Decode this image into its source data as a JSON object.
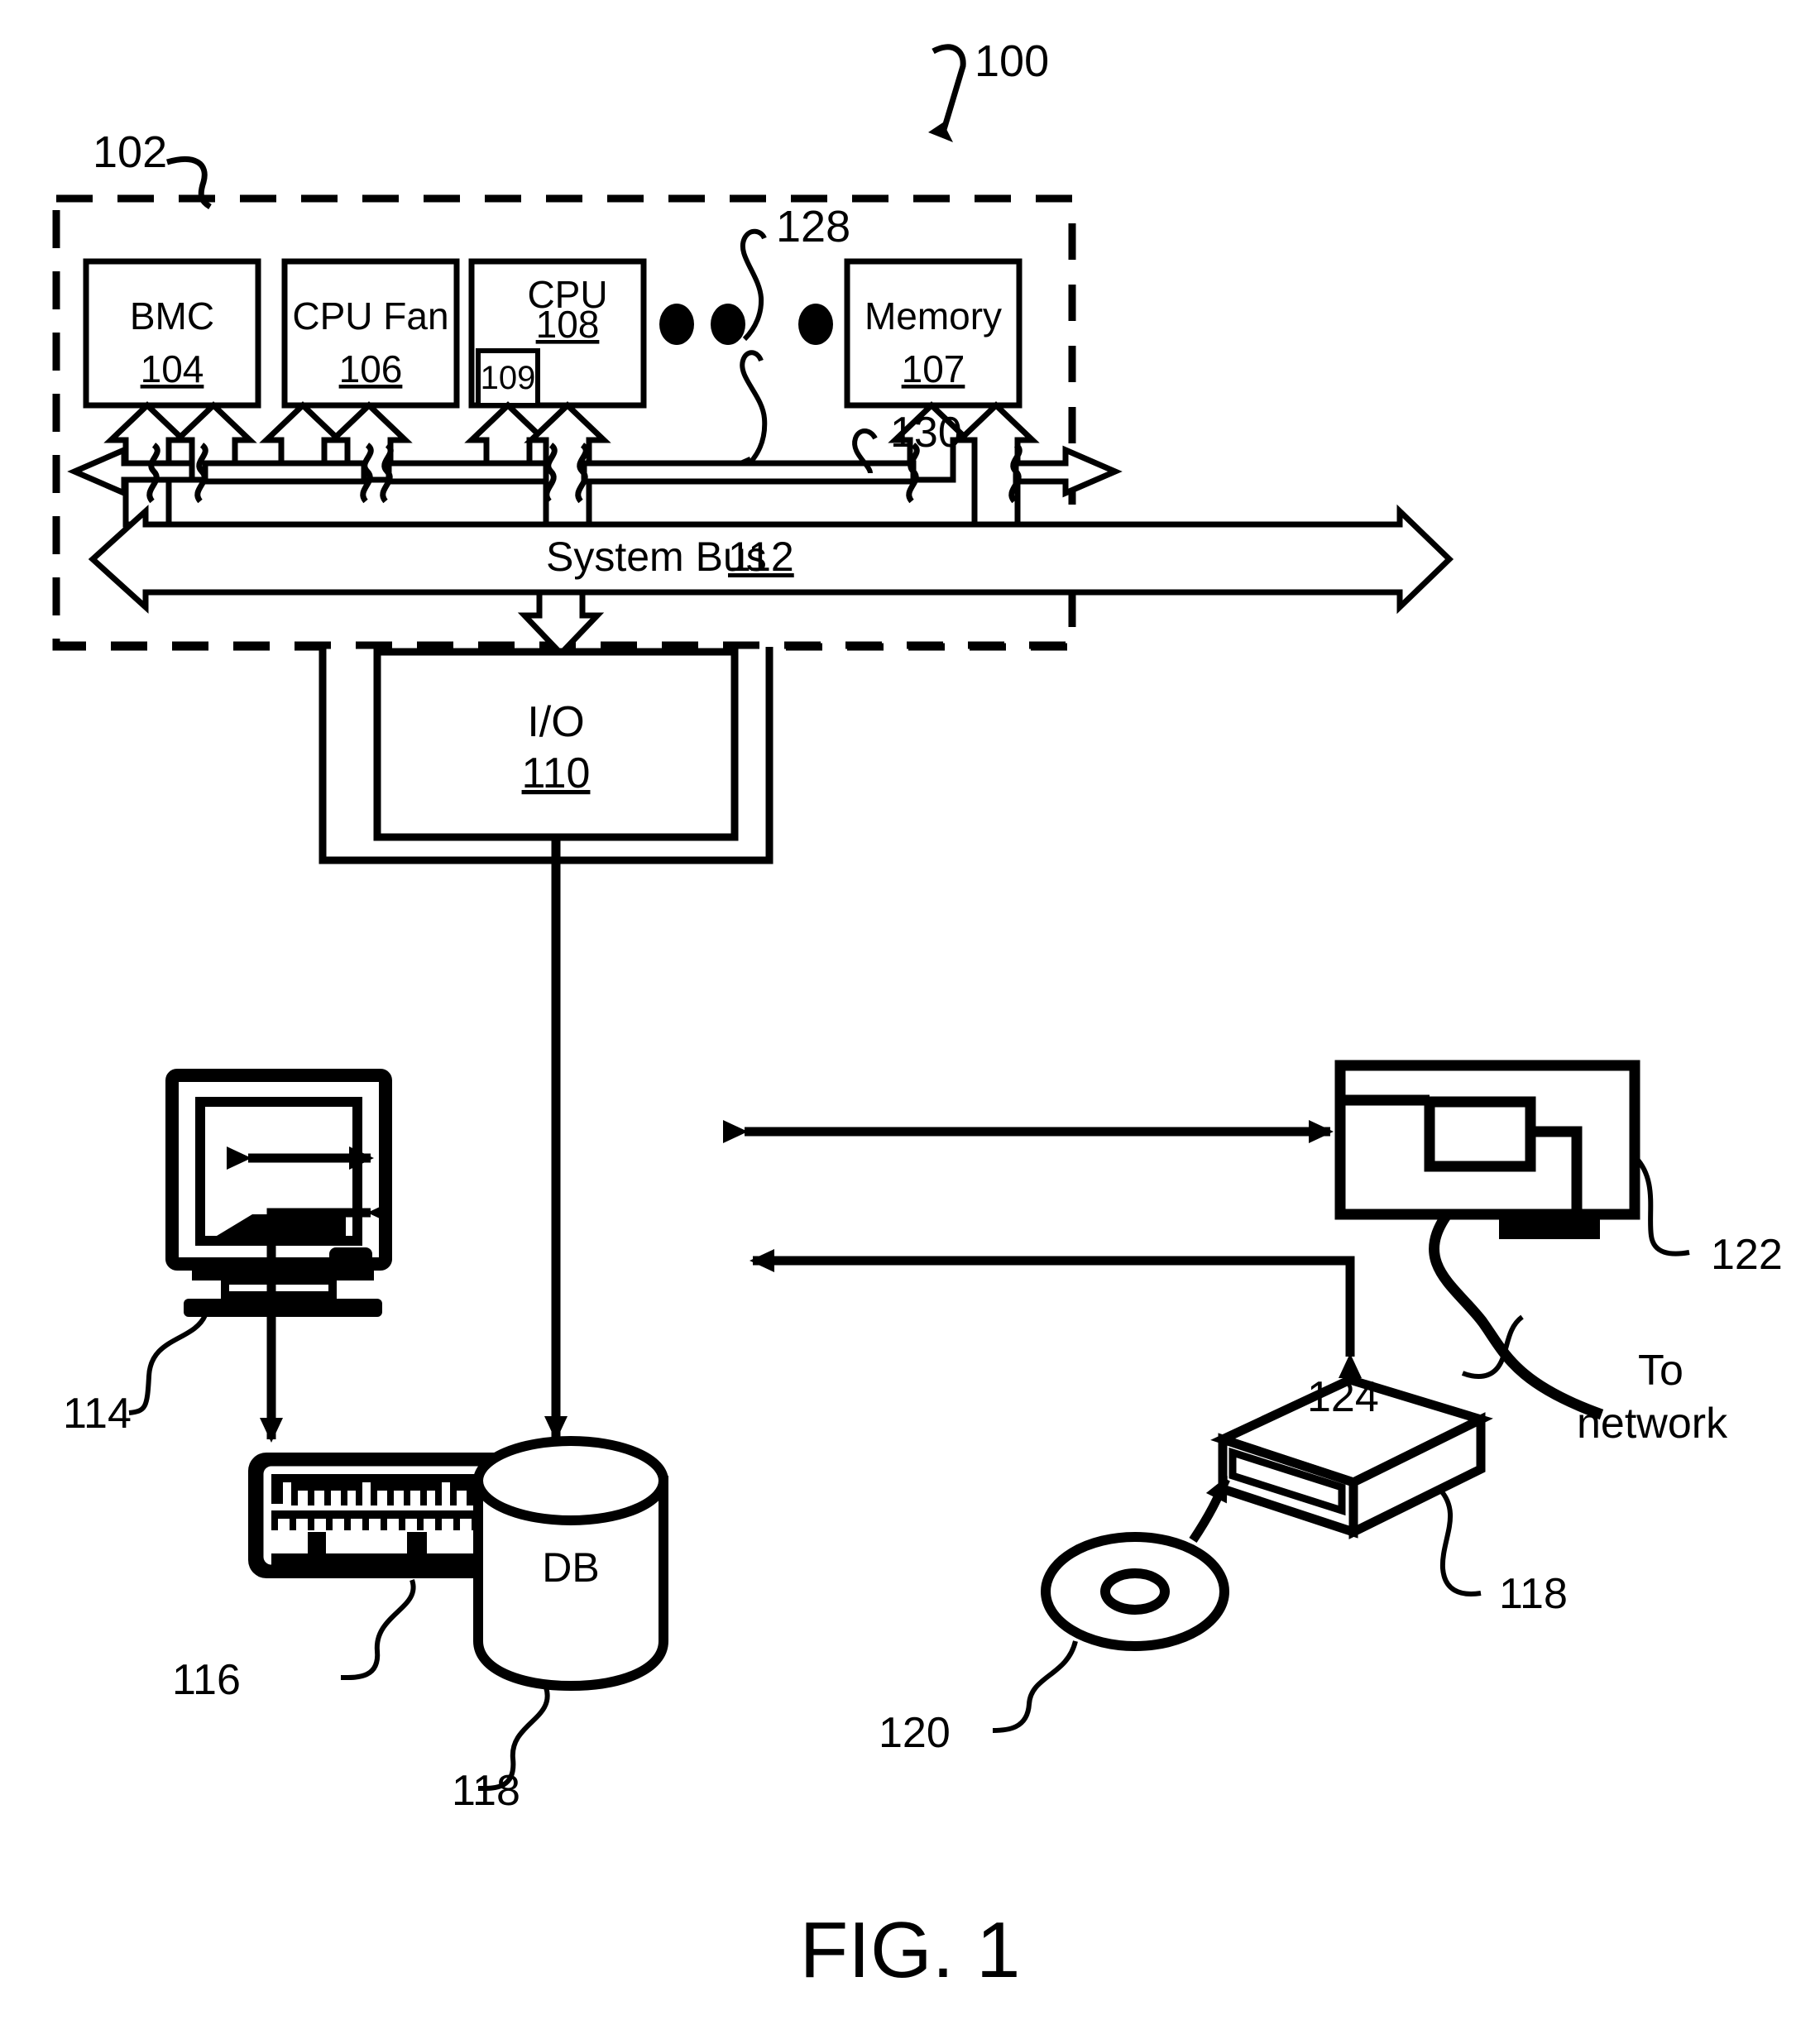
{
  "figure": {
    "caption": "FIG. 1",
    "system_ref": "100",
    "computer_ref": "102"
  },
  "blocks": [
    {
      "id": "bmc",
      "title": "BMC",
      "ref": "104"
    },
    {
      "id": "cpu_fan",
      "title": "CPU Fan",
      "ref": "106"
    },
    {
      "id": "cpu",
      "title": "CPU",
      "ref": "108"
    },
    {
      "id": "memory",
      "title": "Memory",
      "ref": "107"
    },
    {
      "id": "io",
      "title": "I/O",
      "ref": "110"
    }
  ],
  "inner_block": {
    "id": "cpu_register",
    "ref": "109"
  },
  "bus": {
    "label": "System Bus",
    "ref": "112"
  },
  "ellipsis": {
    "ref": "128",
    "dots": 3
  },
  "bus_branch": {
    "ref": "130"
  },
  "peripherals": [
    {
      "id": "monitor",
      "ref": "114",
      "label": ""
    },
    {
      "id": "keyboard",
      "ref": "116",
      "label": ""
    },
    {
      "id": "database",
      "ref": "118",
      "label": "DB"
    },
    {
      "id": "disk_drive",
      "ref": "118",
      "label": ""
    },
    {
      "id": "optical_disc",
      "ref": "120",
      "label": ""
    },
    {
      "id": "network_card",
      "ref": "122",
      "label": ""
    },
    {
      "id": "network_link",
      "ref": "124",
      "label": ""
    }
  ],
  "network": {
    "line1": "To",
    "line2": "network"
  },
  "colors": {
    "ink": "#000000",
    "paper": "#ffffff"
  }
}
